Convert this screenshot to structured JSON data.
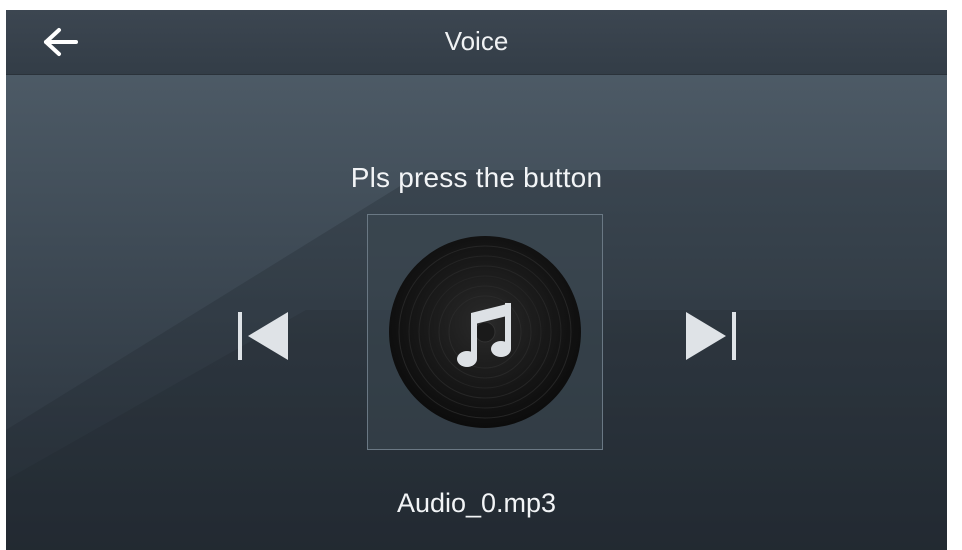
{
  "header": {
    "title": "Voice",
    "back_icon": "arrow-left-icon"
  },
  "main": {
    "prompt": "Pls press the button",
    "album_icon": "music-disc-icon",
    "prev_icon": "skip-previous-icon",
    "next_icon": "skip-next-icon",
    "filename": "Audio_0.mp3"
  },
  "colors": {
    "header_bg": "#363f49",
    "background_top": "#52606c",
    "background_bottom": "#262e37",
    "text": "#f0f2f4",
    "icon": "#dfe3e7"
  }
}
